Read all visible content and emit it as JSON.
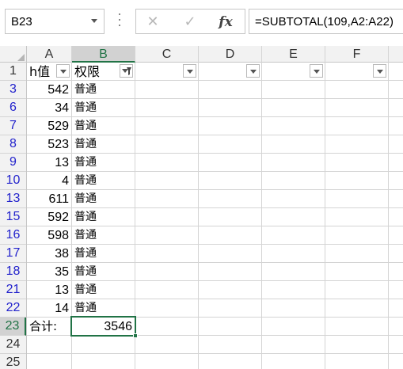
{
  "name_box": {
    "value": "B23"
  },
  "formula_bar": {
    "cancel_icon": "✕",
    "enter_icon": "✓",
    "fx_label": "fx",
    "formula": "=SUBTOTAL(109,A2:A22)"
  },
  "columns": [
    "A",
    "B",
    "C",
    "D",
    "E",
    "F"
  ],
  "selected_column": "B",
  "header_row": {
    "row": "1",
    "a": "h值",
    "b": "权限"
  },
  "rows": [
    {
      "row": "3",
      "a": "542",
      "b": "普通"
    },
    {
      "row": "6",
      "a": "34",
      "b": "普通"
    },
    {
      "row": "7",
      "a": "529",
      "b": "普通"
    },
    {
      "row": "8",
      "a": "523",
      "b": "普通"
    },
    {
      "row": "9",
      "a": "13",
      "b": "普通"
    },
    {
      "row": "10",
      "a": "4",
      "b": "普通"
    },
    {
      "row": "13",
      "a": "611",
      "b": "普通"
    },
    {
      "row": "15",
      "a": "592",
      "b": "普通"
    },
    {
      "row": "16",
      "a": "598",
      "b": "普通"
    },
    {
      "row": "17",
      "a": "38",
      "b": "普通"
    },
    {
      "row": "18",
      "a": "35",
      "b": "普通"
    },
    {
      "row": "21",
      "a": "13",
      "b": "普通"
    },
    {
      "row": "22",
      "a": "14",
      "b": "普通"
    }
  ],
  "total_row": {
    "row": "23",
    "a": "合计:",
    "b": "3546"
  },
  "empty_rows": [
    "24",
    "25"
  ],
  "selected_row": "23",
  "colors": {
    "accent": "#217346",
    "filtered_row_number": "#2222cc"
  }
}
